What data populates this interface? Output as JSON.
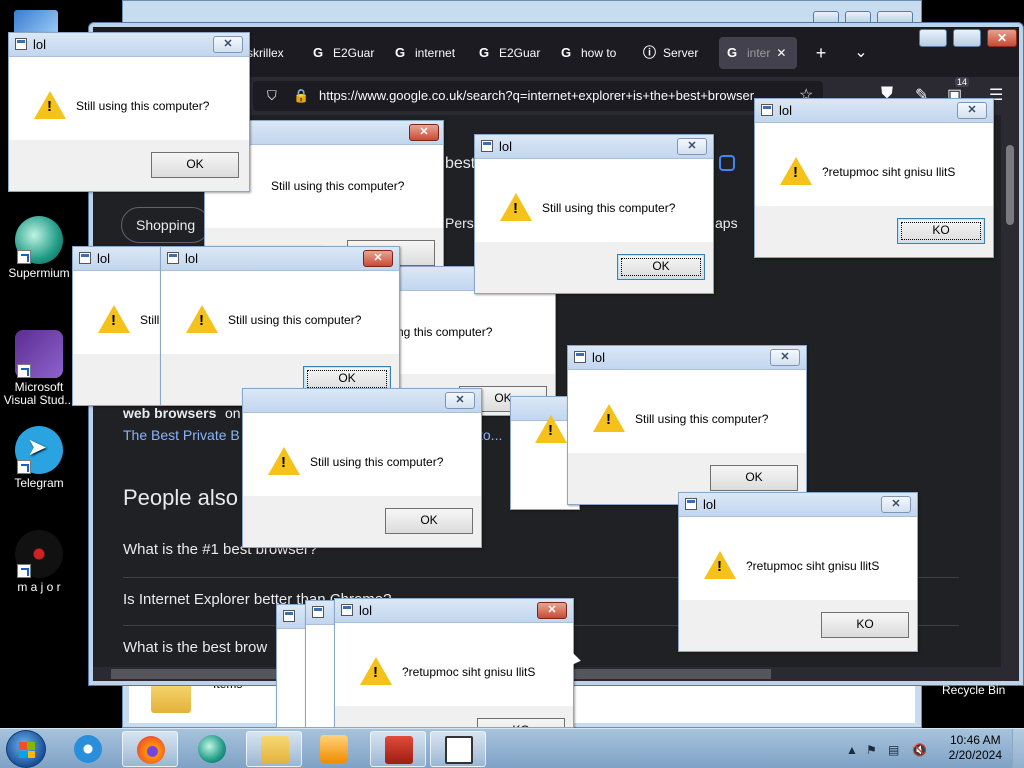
{
  "desktop": {
    "icons": [
      {
        "label": "Supermium"
      },
      {
        "label": "Microsoft Visual Stud..."
      },
      {
        "label": "Telegram"
      },
      {
        "label": "m a j o r"
      },
      {
        "label": "Recycle Bin"
      }
    ]
  },
  "explorer": {
    "partial_text": "Items"
  },
  "browser": {
    "tabs": [
      {
        "label": "skrillex"
      },
      {
        "label": "E2Guar"
      },
      {
        "label": "internet"
      },
      {
        "label": "E2Guar"
      },
      {
        "label": "how to"
      },
      {
        "label": "Server"
      },
      {
        "label": "inter"
      }
    ],
    "active_tab_close": "✕",
    "new_tab": "+",
    "tab_list": "⌄",
    "url": "https://www.google.co.uk/search?q=internet+explorer+is+the+best+browser",
    "notification_count": "14",
    "search_partial": "best",
    "chips": [
      {
        "label": "Shopping"
      },
      {
        "label": "Pers"
      },
      {
        "label": "aps"
      }
    ],
    "result_bold": "web browsers",
    "result_on": "on",
    "result_link": "The Best Private B",
    "result_link_tail": "to...",
    "people_also": "People also",
    "questions": [
      "What is the #1 best browser?",
      "Is Internet Explorer better than Chrome?",
      "What is the best brow"
    ]
  },
  "dialogs": {
    "title": "lol",
    "message": "Still using this computer?",
    "message_reversed": "?retupmoc siht gnisu llitS",
    "ok": "OK",
    "ok_reversed": "KO",
    "close_glyph": "✕",
    "warn_glyph": "!"
  },
  "taskbar": {
    "time": "10:46 AM",
    "date": "2/20/2024"
  },
  "colors": {
    "dialog_title_gradient_top": "#dbe8f6",
    "warning_yellow": "#f4c21b",
    "google_dark_bg": "#202124",
    "firefox_toolbar": "#2b2a33"
  }
}
